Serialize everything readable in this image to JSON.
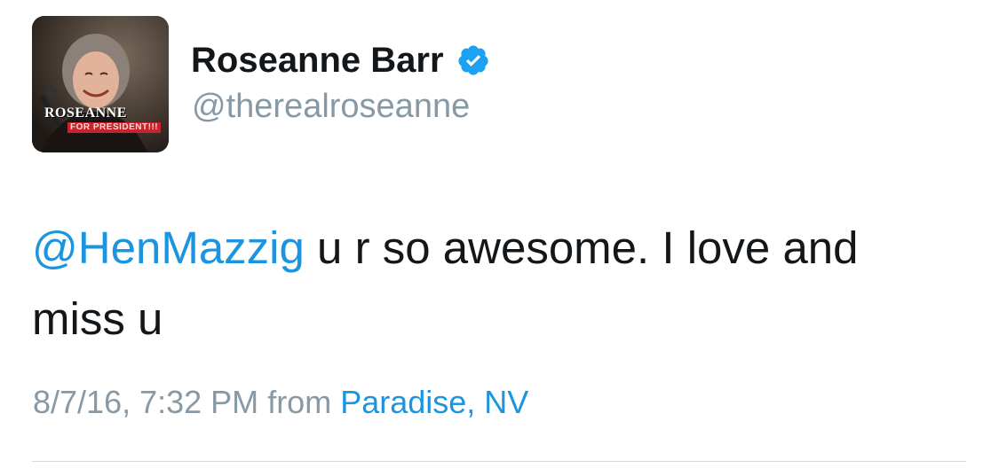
{
  "user": {
    "display_name": "Roseanne Barr",
    "handle": "@therealroseanne",
    "verified": true,
    "avatar_text": "ROSEANNE",
    "avatar_subtext": "FOR PRESIDENT!!!"
  },
  "tweet": {
    "mention": "@HenMazzig",
    "text": " u r so awesome. I love and miss u"
  },
  "meta": {
    "timestamp": "8/7/16, 7:32 PM",
    "from_label": "from",
    "location": "Paradise, NV"
  },
  "colors": {
    "link": "#1b95e0",
    "text": "#14171a",
    "muted": "#8899a6",
    "verified_badge": "#1da1f2"
  },
  "icons": {
    "verified": "verified-badge-icon"
  }
}
